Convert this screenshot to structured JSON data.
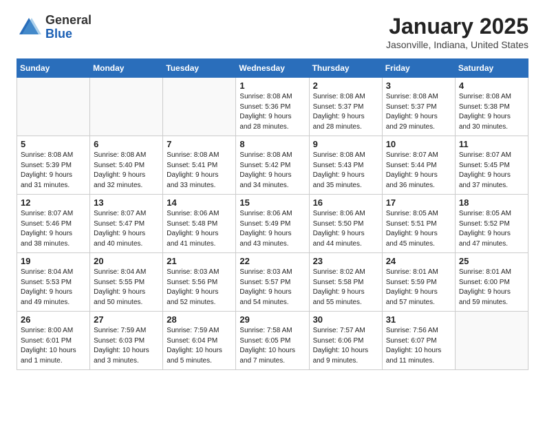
{
  "logo": {
    "general": "General",
    "blue": "Blue"
  },
  "header": {
    "month_year": "January 2025",
    "location": "Jasonville, Indiana, United States"
  },
  "weekdays": [
    "Sunday",
    "Monday",
    "Tuesday",
    "Wednesday",
    "Thursday",
    "Friday",
    "Saturday"
  ],
  "weeks": [
    [
      {
        "day": "",
        "info": ""
      },
      {
        "day": "",
        "info": ""
      },
      {
        "day": "",
        "info": ""
      },
      {
        "day": "1",
        "info": "Sunrise: 8:08 AM\nSunset: 5:36 PM\nDaylight: 9 hours\nand 28 minutes."
      },
      {
        "day": "2",
        "info": "Sunrise: 8:08 AM\nSunset: 5:37 PM\nDaylight: 9 hours\nand 28 minutes."
      },
      {
        "day": "3",
        "info": "Sunrise: 8:08 AM\nSunset: 5:37 PM\nDaylight: 9 hours\nand 29 minutes."
      },
      {
        "day": "4",
        "info": "Sunrise: 8:08 AM\nSunset: 5:38 PM\nDaylight: 9 hours\nand 30 minutes."
      }
    ],
    [
      {
        "day": "5",
        "info": "Sunrise: 8:08 AM\nSunset: 5:39 PM\nDaylight: 9 hours\nand 31 minutes."
      },
      {
        "day": "6",
        "info": "Sunrise: 8:08 AM\nSunset: 5:40 PM\nDaylight: 9 hours\nand 32 minutes."
      },
      {
        "day": "7",
        "info": "Sunrise: 8:08 AM\nSunset: 5:41 PM\nDaylight: 9 hours\nand 33 minutes."
      },
      {
        "day": "8",
        "info": "Sunrise: 8:08 AM\nSunset: 5:42 PM\nDaylight: 9 hours\nand 34 minutes."
      },
      {
        "day": "9",
        "info": "Sunrise: 8:08 AM\nSunset: 5:43 PM\nDaylight: 9 hours\nand 35 minutes."
      },
      {
        "day": "10",
        "info": "Sunrise: 8:07 AM\nSunset: 5:44 PM\nDaylight: 9 hours\nand 36 minutes."
      },
      {
        "day": "11",
        "info": "Sunrise: 8:07 AM\nSunset: 5:45 PM\nDaylight: 9 hours\nand 37 minutes."
      }
    ],
    [
      {
        "day": "12",
        "info": "Sunrise: 8:07 AM\nSunset: 5:46 PM\nDaylight: 9 hours\nand 38 minutes."
      },
      {
        "day": "13",
        "info": "Sunrise: 8:07 AM\nSunset: 5:47 PM\nDaylight: 9 hours\nand 40 minutes."
      },
      {
        "day": "14",
        "info": "Sunrise: 8:06 AM\nSunset: 5:48 PM\nDaylight: 9 hours\nand 41 minutes."
      },
      {
        "day": "15",
        "info": "Sunrise: 8:06 AM\nSunset: 5:49 PM\nDaylight: 9 hours\nand 43 minutes."
      },
      {
        "day": "16",
        "info": "Sunrise: 8:06 AM\nSunset: 5:50 PM\nDaylight: 9 hours\nand 44 minutes."
      },
      {
        "day": "17",
        "info": "Sunrise: 8:05 AM\nSunset: 5:51 PM\nDaylight: 9 hours\nand 45 minutes."
      },
      {
        "day": "18",
        "info": "Sunrise: 8:05 AM\nSunset: 5:52 PM\nDaylight: 9 hours\nand 47 minutes."
      }
    ],
    [
      {
        "day": "19",
        "info": "Sunrise: 8:04 AM\nSunset: 5:53 PM\nDaylight: 9 hours\nand 49 minutes."
      },
      {
        "day": "20",
        "info": "Sunrise: 8:04 AM\nSunset: 5:55 PM\nDaylight: 9 hours\nand 50 minutes."
      },
      {
        "day": "21",
        "info": "Sunrise: 8:03 AM\nSunset: 5:56 PM\nDaylight: 9 hours\nand 52 minutes."
      },
      {
        "day": "22",
        "info": "Sunrise: 8:03 AM\nSunset: 5:57 PM\nDaylight: 9 hours\nand 54 minutes."
      },
      {
        "day": "23",
        "info": "Sunrise: 8:02 AM\nSunset: 5:58 PM\nDaylight: 9 hours\nand 55 minutes."
      },
      {
        "day": "24",
        "info": "Sunrise: 8:01 AM\nSunset: 5:59 PM\nDaylight: 9 hours\nand 57 minutes."
      },
      {
        "day": "25",
        "info": "Sunrise: 8:01 AM\nSunset: 6:00 PM\nDaylight: 9 hours\nand 59 minutes."
      }
    ],
    [
      {
        "day": "26",
        "info": "Sunrise: 8:00 AM\nSunset: 6:01 PM\nDaylight: 10 hours\nand 1 minute."
      },
      {
        "day": "27",
        "info": "Sunrise: 7:59 AM\nSunset: 6:03 PM\nDaylight: 10 hours\nand 3 minutes."
      },
      {
        "day": "28",
        "info": "Sunrise: 7:59 AM\nSunset: 6:04 PM\nDaylight: 10 hours\nand 5 minutes."
      },
      {
        "day": "29",
        "info": "Sunrise: 7:58 AM\nSunset: 6:05 PM\nDaylight: 10 hours\nand 7 minutes."
      },
      {
        "day": "30",
        "info": "Sunrise: 7:57 AM\nSunset: 6:06 PM\nDaylight: 10 hours\nand 9 minutes."
      },
      {
        "day": "31",
        "info": "Sunrise: 7:56 AM\nSunset: 6:07 PM\nDaylight: 10 hours\nand 11 minutes."
      },
      {
        "day": "",
        "info": ""
      }
    ]
  ]
}
